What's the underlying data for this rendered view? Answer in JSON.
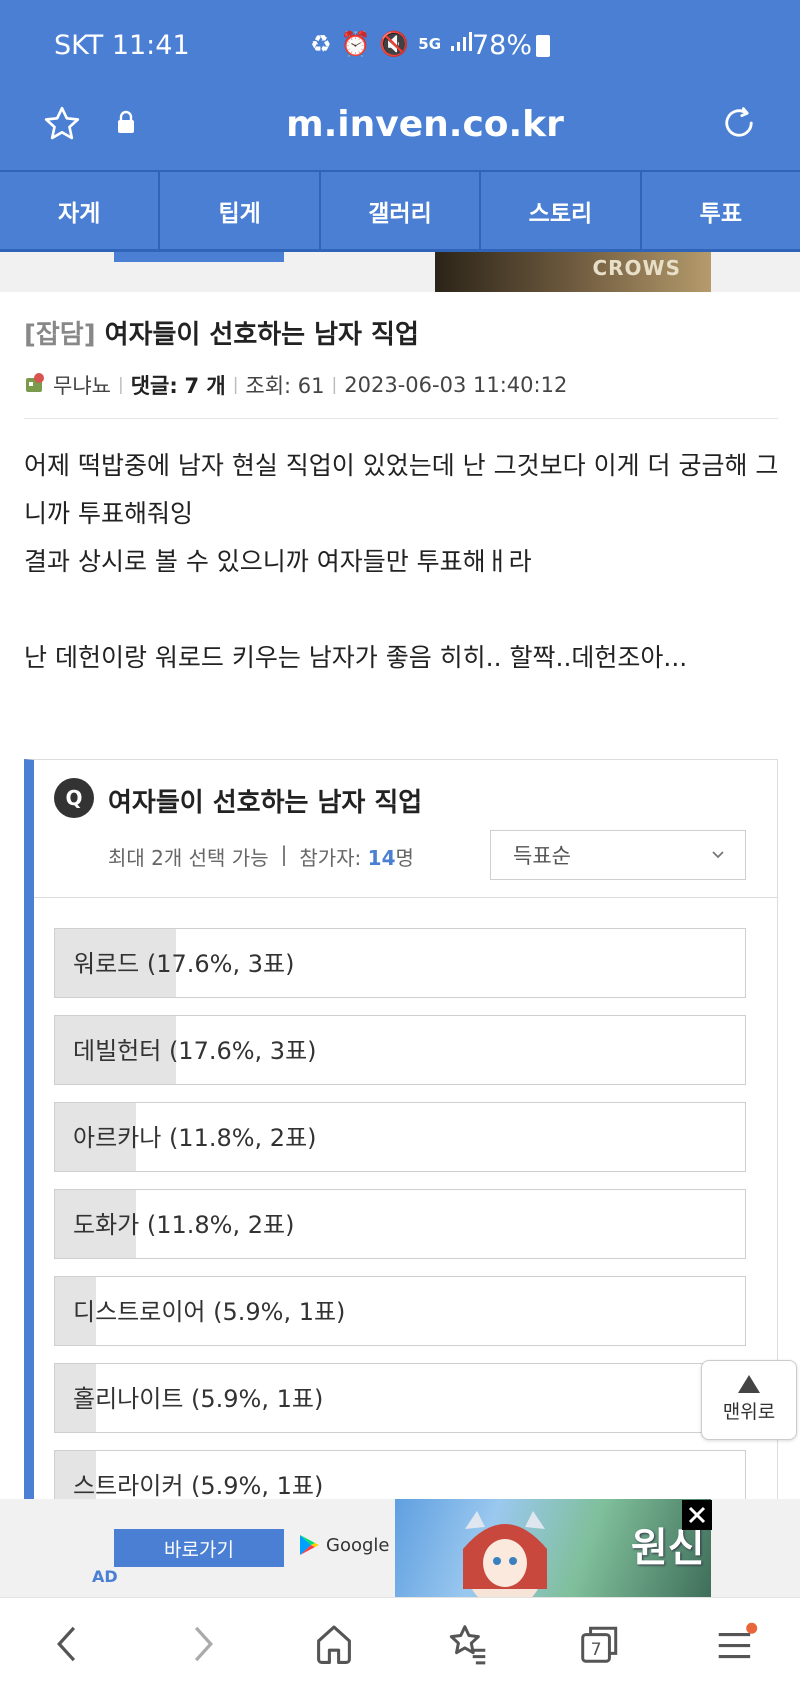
{
  "status_bar": {
    "time": "SKT 11:41",
    "battery": "78%"
  },
  "address_bar": {
    "url": "m.inven.co.kr"
  },
  "tabs": [
    {
      "label": "자게"
    },
    {
      "label": "팁게"
    },
    {
      "label": "갤러리"
    },
    {
      "label": "스토리"
    },
    {
      "label": "투표"
    }
  ],
  "top_banner": {
    "text": "CROWS"
  },
  "article": {
    "category": "[잡담]",
    "title": "여자들이 선호하는 남자 직업",
    "author": "무냐뇨",
    "comments_label": "댓글:",
    "comments": "7 개",
    "views": "조회: 61",
    "date": "2023-06-03 11:40:12",
    "body": [
      "어제 떡밥중에 남자 현실 직업이 있었는데 난 그것보다 이게 더 궁금해 그니까 투표해줘잉",
      "결과 상시로 볼 수 있으니까 여자들만 투표해ㅐ라",
      "",
      "난 데헌이랑 워로드 키우는 남자가 좋음 히히.. 할짝..데헌조아..."
    ]
  },
  "poll": {
    "badge": "Q",
    "title": "여자들이 선호하는 남자 직업",
    "max_select": "최대 2개 선택 가능",
    "divider": "|",
    "participants_label": "참가자:",
    "participants": "14",
    "participants_unit": "명",
    "sort": "득표순",
    "options": [
      {
        "label": "워로드 (17.6%, 3표)",
        "percent": 17.6
      },
      {
        "label": "데빌헌터 (17.6%, 3표)",
        "percent": 17.6
      },
      {
        "label": "아르카나 (11.8%, 2표)",
        "percent": 11.8
      },
      {
        "label": "도화가 (11.8%, 2표)",
        "percent": 11.8
      },
      {
        "label": "디스트로이어 (5.9%, 1표)",
        "percent": 5.9
      },
      {
        "label": "홀리나이트 (5.9%, 1표)",
        "percent": 5.9
      },
      {
        "label": "스트라이커 (5.9%, 1표)",
        "percent": 5.9
      }
    ]
  },
  "to_top": {
    "label": "맨위로"
  },
  "bottom_ad": {
    "button": "바로가기",
    "store": "Google Play",
    "ad_label": "AD",
    "logo": "원신"
  },
  "nav": {
    "tabs_count": "7"
  },
  "colors": {
    "brand": "#4a7fd3",
    "notification_dot": "#e8663a"
  }
}
